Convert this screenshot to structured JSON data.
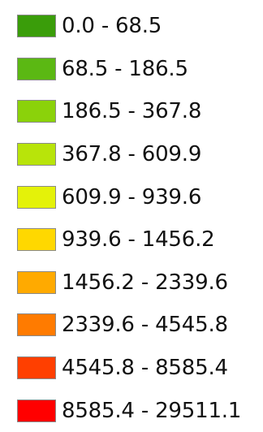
{
  "legend": {
    "items": [
      {
        "label": "0.0 - 68.5",
        "color": "#3a9d0a"
      },
      {
        "label": "68.5 - 186.5",
        "color": "#5bb813"
      },
      {
        "label": "186.5 - 367.8",
        "color": "#8bd20a"
      },
      {
        "label": "367.8 - 609.9",
        "color": "#b8e40a"
      },
      {
        "label": "609.9 - 939.6",
        "color": "#e4f209"
      },
      {
        "label": "939.6 - 1456.2",
        "color": "#ffd800"
      },
      {
        "label": "1456.2 - 2339.6",
        "color": "#ffaa00"
      },
      {
        "label": "2339.6 - 4545.8",
        "color": "#ff7b00"
      },
      {
        "label": "4545.8 - 8585.4",
        "color": "#ff3f00"
      },
      {
        "label": "8585.4 - 29511.1",
        "color": "#ff0000"
      }
    ]
  }
}
